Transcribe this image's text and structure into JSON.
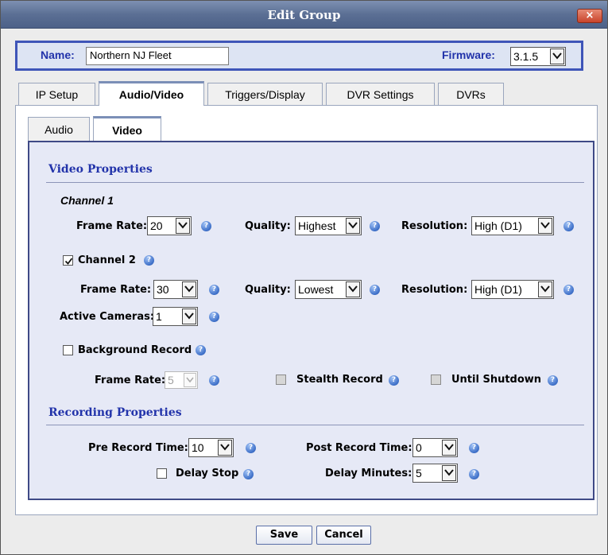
{
  "window": {
    "title": "Edit Group",
    "close_glyph": "×"
  },
  "header": {
    "name_label": "Name:",
    "name_value": "Northern NJ Fleet",
    "firmware_label": "Firmware:",
    "firmware_value": "3.1.5"
  },
  "tabs": [
    {
      "label": "IP Setup",
      "active": false
    },
    {
      "label": "Audio/Video",
      "active": true
    },
    {
      "label": "Triggers/Display",
      "active": false
    },
    {
      "label": "DVR Settings",
      "active": false
    },
    {
      "label": "DVRs",
      "active": false
    }
  ],
  "subtabs": [
    {
      "label": "Audio",
      "active": false
    },
    {
      "label": "Video",
      "active": true
    }
  ],
  "video": {
    "section_title": "Video Properties",
    "channel1": {
      "label": "Channel 1",
      "frame_rate_label": "Frame Rate:",
      "frame_rate": "20",
      "quality_label": "Quality:",
      "quality": "Highest",
      "resolution_label": "Resolution:",
      "resolution": "High (D1)"
    },
    "channel2": {
      "label": "Channel 2",
      "checked": true,
      "frame_rate_label": "Frame Rate:",
      "frame_rate": "30",
      "quality_label": "Quality:",
      "quality": "Lowest",
      "resolution_label": "Resolution:",
      "resolution": "High (D1)"
    },
    "active_cameras_label": "Active Cameras:",
    "active_cameras": "1",
    "background_record": {
      "label": "Background Record",
      "checked": false,
      "frame_rate_label": "Frame Rate:",
      "frame_rate": "5",
      "stealth_label": "Stealth Record",
      "until_shutdown_label": "Until Shutdown"
    }
  },
  "recording": {
    "section_title": "Recording Properties",
    "pre_label": "Pre Record Time:",
    "pre_value": "10",
    "post_label": "Post Record Time:",
    "post_value": "0",
    "delay_stop_label": "Delay Stop",
    "delay_stop_checked": false,
    "delay_minutes_label": "Delay Minutes:",
    "delay_minutes": "5"
  },
  "buttons": {
    "save": "Save",
    "cancel": "Cancel"
  },
  "colors": {
    "title_bar": "#5b6f94",
    "section_title": "#2233aa",
    "panel_border": "#3f4a86",
    "panel_bg": "#e6e9f6",
    "help_icon": "#3d6fc8"
  }
}
